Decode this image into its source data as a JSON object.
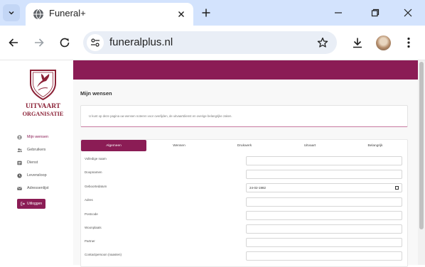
{
  "browser": {
    "tab_title": "Funeral+",
    "url": "funeralplus.nl"
  },
  "logo": {
    "line1": "UITVAART",
    "line2": "ORGANISATIE"
  },
  "sidebar": {
    "items": [
      {
        "label": "Mijn wensen",
        "icon": "person-circle-icon",
        "active": true
      },
      {
        "label": "Gebruikers",
        "icon": "users-icon",
        "active": false
      },
      {
        "label": "Dienst",
        "icon": "list-icon",
        "active": false
      },
      {
        "label": "Levensloop",
        "icon": "clock-icon",
        "active": false
      },
      {
        "label": "Adressenlijst",
        "icon": "envelope-icon",
        "active": false
      }
    ],
    "logout_label": "Uitloggen"
  },
  "main": {
    "title": "Mijn wensen",
    "info": "U kunt op deze pagina uw wensen noteren voor overlijden, de uitvaartdienst en overige belangrijke zaken.",
    "tabs": [
      "Algemeen",
      "Wensen",
      "Drukwerk",
      "Uitvaart",
      "Belangrijk"
    ],
    "active_tab": "Algemeen",
    "fields": [
      {
        "label": "Volledige naam",
        "value": ""
      },
      {
        "label": "Doopnamen",
        "value": ""
      },
      {
        "label": "Geboortedatum",
        "value": "24-02-1982"
      },
      {
        "label": "Adres",
        "value": ""
      },
      {
        "label": "Postcode",
        "value": ""
      },
      {
        "label": "Woonplaats",
        "value": ""
      },
      {
        "label": "Partner",
        "value": ""
      },
      {
        "label": "Contactpersoon (naasten)",
        "value": ""
      }
    ]
  },
  "colors": {
    "brand": "#8b1c55",
    "logo": "#8b2136",
    "chrome_tabstrip": "#d3e3fd"
  }
}
